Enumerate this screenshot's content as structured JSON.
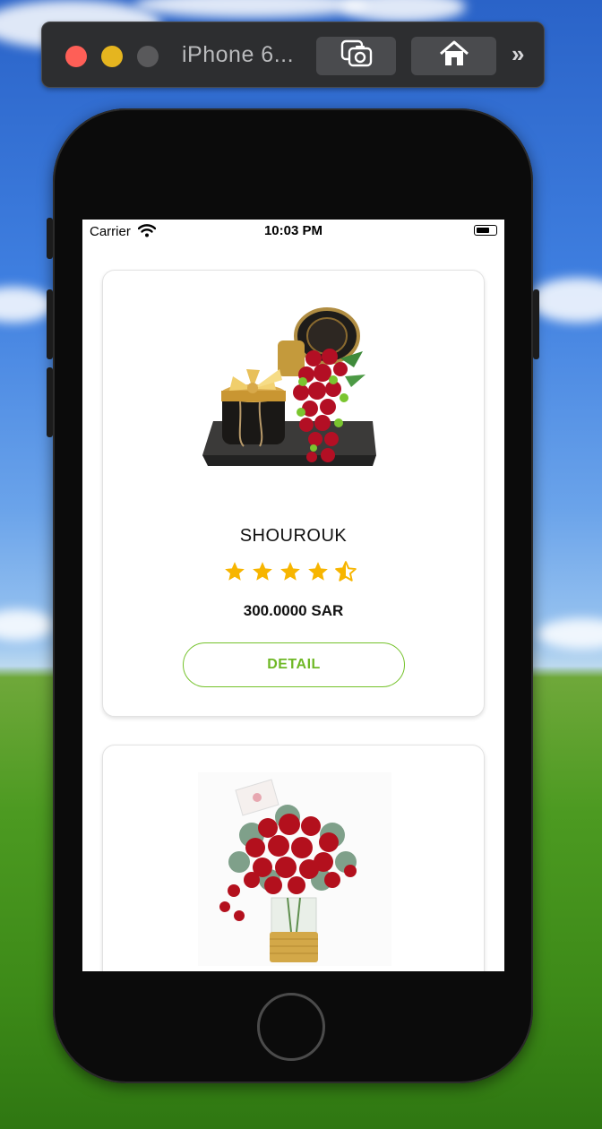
{
  "window": {
    "title": "iPhone 6...",
    "screenshot_button": "screenshot-icon",
    "home_button": "home-icon",
    "more_button": "»"
  },
  "status_bar": {
    "carrier": "Carrier",
    "time": "10:03 PM"
  },
  "products": [
    {
      "name": "SHOUROUK",
      "rating": 4.5,
      "price": "300.0000 SAR",
      "detail_label": "DETAIL",
      "image": "gift-box-with-red-roses-image"
    },
    {
      "name": "",
      "image": "red-roses-bouquet-in-vase-image"
    }
  ],
  "colors": {
    "accent_green": "#74c22a",
    "star": "#f7b500"
  }
}
